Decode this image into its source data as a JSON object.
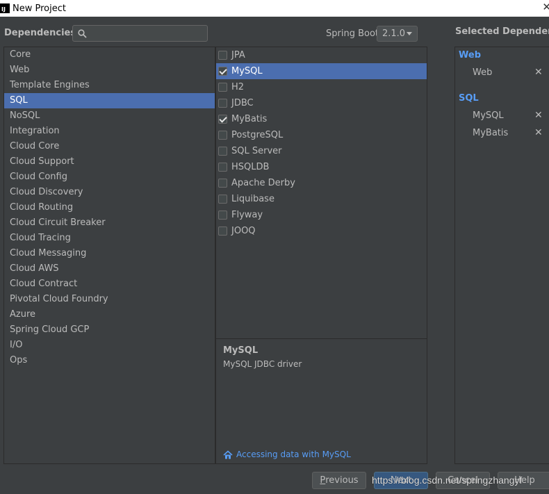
{
  "window": {
    "title": "New Project",
    "logo_text": "IJ"
  },
  "header": {
    "dependencies_label": "Dependencies",
    "search_placeholder": "",
    "spring_boot_label": "Spring Boot",
    "spring_boot_version": "2.1.0",
    "selected_label": "Selected Dependencies"
  },
  "categories": [
    "Core",
    "Web",
    "Template Engines",
    "SQL",
    "NoSQL",
    "Integration",
    "Cloud Core",
    "Cloud Support",
    "Cloud Config",
    "Cloud Discovery",
    "Cloud Routing",
    "Cloud Circuit Breaker",
    "Cloud Tracing",
    "Cloud Messaging",
    "Cloud AWS",
    "Cloud Contract",
    "Pivotal Cloud Foundry",
    "Azure",
    "Spring Cloud GCP",
    "I/O",
    "Ops"
  ],
  "selected_category": "SQL",
  "dependencies": [
    {
      "label": "JPA",
      "checked": false
    },
    {
      "label": "MySQL",
      "checked": true
    },
    {
      "label": "H2",
      "checked": false
    },
    {
      "label": "JDBC",
      "checked": false
    },
    {
      "label": "MyBatis",
      "checked": true
    },
    {
      "label": "PostgreSQL",
      "checked": false
    },
    {
      "label": "SQL Server",
      "checked": false
    },
    {
      "label": "HSQLDB",
      "checked": false
    },
    {
      "label": "Apache Derby",
      "checked": false
    },
    {
      "label": "Liquibase",
      "checked": false
    },
    {
      "label": "Flyway",
      "checked": false
    },
    {
      "label": "JOOQ",
      "checked": false
    }
  ],
  "selected_dependency": "MySQL",
  "description": {
    "title": "MySQL",
    "text": "MySQL JDBC driver",
    "guide_link": "Accessing data with MySQL"
  },
  "selected": {
    "groups": [
      {
        "name": "Web",
        "items": [
          "Web"
        ]
      },
      {
        "name": "SQL",
        "items": [
          "MySQL",
          "MyBatis"
        ]
      }
    ],
    "remove_glyph": "✕"
  },
  "buttons": {
    "previous_mnemonic": "P",
    "previous_rest": "revious",
    "next": "Next",
    "cancel": "Cancel",
    "help": "Help"
  },
  "watermark": "https://blog.csdn.net/springzhangyf",
  "colors": {
    "accent": "#4b6eaf",
    "link": "#589df6",
    "background": "#3c3f41"
  }
}
